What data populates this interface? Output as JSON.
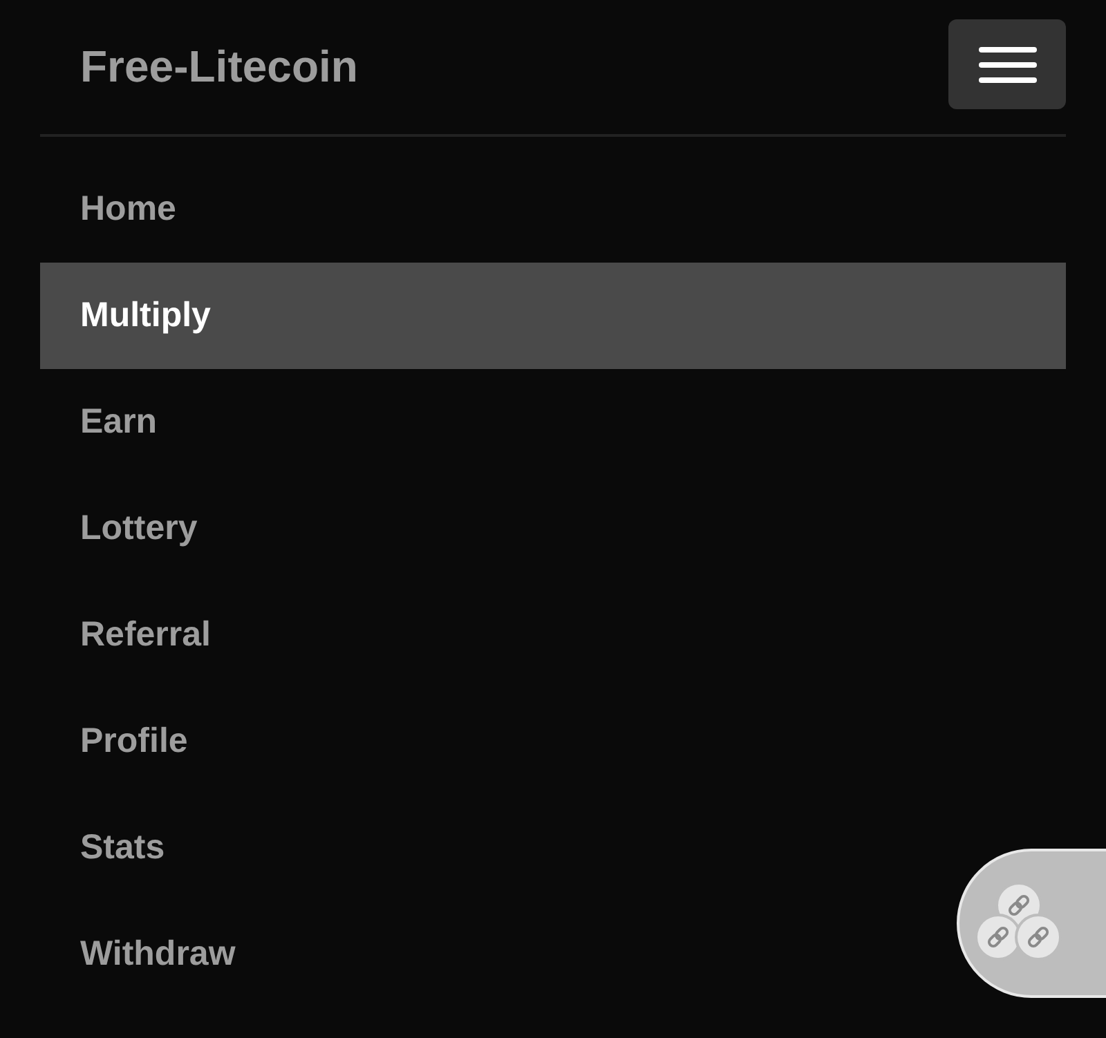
{
  "brand": "Free-Litecoin",
  "nav": [
    {
      "label": "Home",
      "selected": false
    },
    {
      "label": "Multiply",
      "selected": true
    },
    {
      "label": "Earn",
      "selected": false
    },
    {
      "label": "Lottery",
      "selected": false
    },
    {
      "label": "Referral",
      "selected": false
    },
    {
      "label": "Profile",
      "selected": false
    },
    {
      "label": "Stats",
      "selected": false
    },
    {
      "label": "Withdraw",
      "selected": false
    }
  ]
}
